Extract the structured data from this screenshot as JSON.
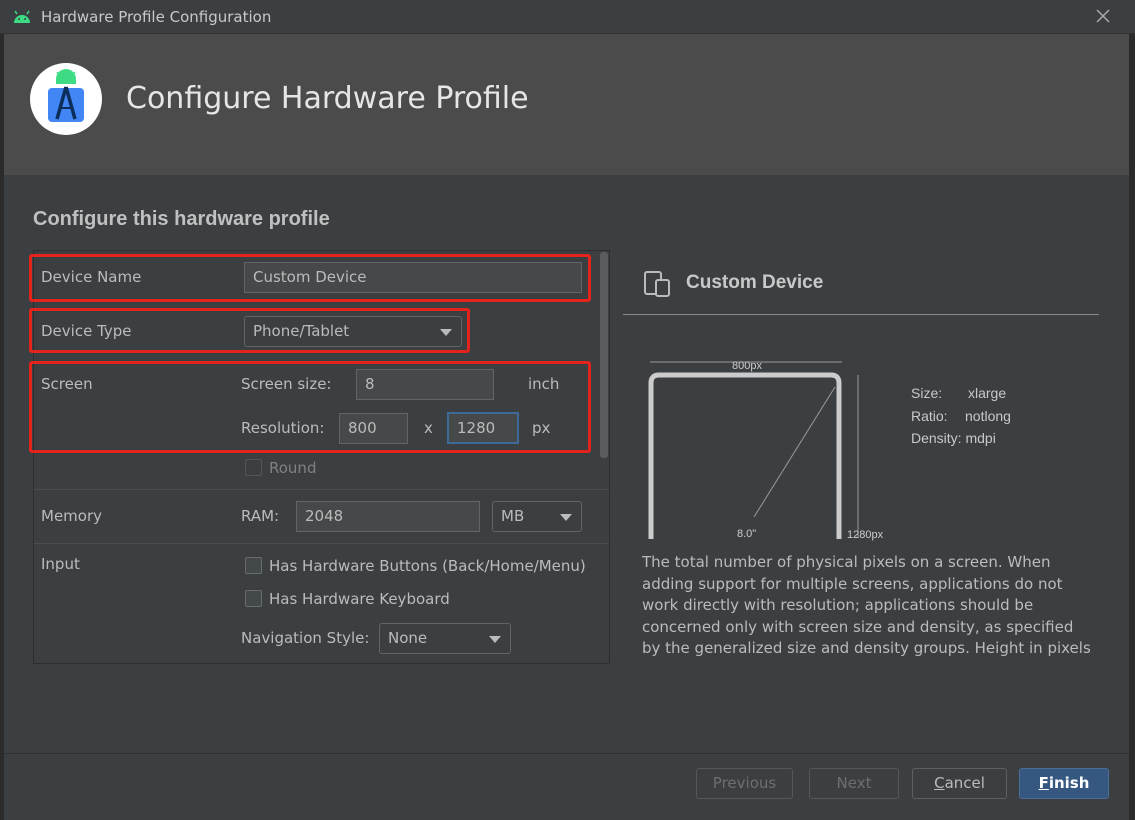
{
  "window": {
    "title": "Hardware Profile Configuration",
    "icon": "android-icon"
  },
  "header": {
    "title": "Configure Hardware Profile",
    "logo": "android-studio-logo"
  },
  "section_title": "Configure this hardware profile",
  "form": {
    "device_name": {
      "label": "Device Name",
      "value": "Custom Device"
    },
    "device_type": {
      "label": "Device Type",
      "value": "Phone/Tablet"
    },
    "screen": {
      "label": "Screen",
      "size_label": "Screen size:",
      "size_value": "8",
      "size_unit": "inch",
      "resolution_label": "Resolution:",
      "res_x": "800",
      "res_sep": "x",
      "res_y": "1280",
      "res_unit": "px",
      "round_label": "Round"
    },
    "memory": {
      "label": "Memory",
      "ram_label": "RAM:",
      "ram_value": "2048",
      "ram_unit": "MB"
    },
    "input": {
      "label": "Input",
      "hw_buttons": "Has Hardware Buttons (Back/Home/Menu)",
      "hw_keyboard": "Has Hardware Keyboard",
      "nav_label": "Navigation Style:",
      "nav_value": "None"
    }
  },
  "preview": {
    "title": "Custom Device",
    "width_label": "800px",
    "height_label": "1280px",
    "diag_label": "8.0\"",
    "size": "Size:",
    "size_val": "xlarge",
    "ratio": "Ratio:",
    "ratio_val": "notlong",
    "density": "Density: mdpi",
    "description": "The total number of physical pixels on a screen. When adding support for multiple screens, applications do not work directly with resolution; applications should be concerned only with screen size and density, as specified by the generalized size and density groups. Height in pixels"
  },
  "footer": {
    "previous": "Previous",
    "next": "Next",
    "cancel_mnemonic": "C",
    "cancel_rest": "ancel",
    "finish_mnemonic": "F",
    "finish_rest": "inish"
  },
  "colors": {
    "highlight": "#e3241c",
    "accent": "#365880",
    "background": "#3c3f41"
  }
}
